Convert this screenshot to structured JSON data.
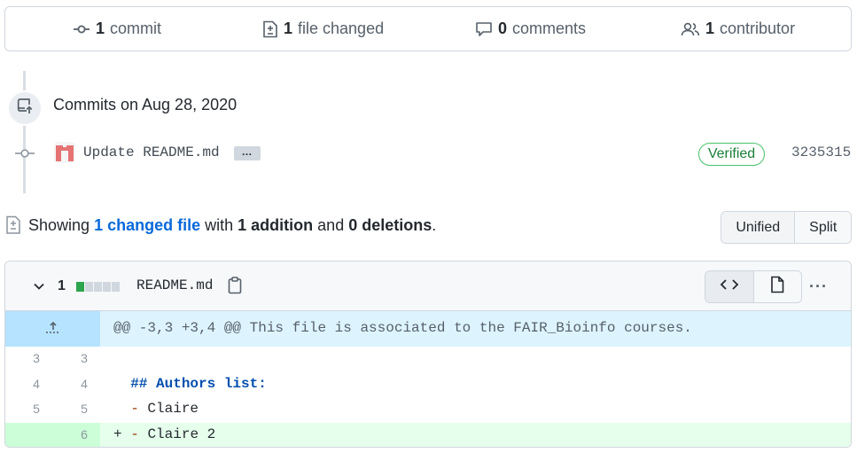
{
  "stats": {
    "commits": {
      "count": "1",
      "label": "commit"
    },
    "files": {
      "count": "1",
      "label": "file changed"
    },
    "comments": {
      "count": "0",
      "label": "comments"
    },
    "contributors": {
      "count": "1",
      "label": "contributor"
    }
  },
  "timeline": {
    "date_label": "Commits on Aug 28, 2020",
    "commit": {
      "message": "Update README.md",
      "ellipsis": "…",
      "verified": "Verified",
      "sha": "3235315"
    }
  },
  "summary": {
    "showing": "Showing",
    "link": "1 changed file",
    "with": "with",
    "additions": "1 addition",
    "and": "and",
    "deletions": "0 deletions",
    "period": "."
  },
  "view_toggle": {
    "unified": "Unified",
    "split": "Split",
    "selected": "Unified"
  },
  "file": {
    "change_count": "1",
    "name": "README.md",
    "more": "···",
    "diffstat": {
      "additions": 1,
      "deletions": 0,
      "colors": [
        "#2da44e",
        "#d0d7de",
        "#d0d7de",
        "#d0d7de",
        "#d0d7de"
      ]
    },
    "hunk_header": "@@ -3,3 +3,4 @@ This file is associated to the FAIR_Bioinfo courses.",
    "lines": [
      {
        "old": "3",
        "new": "3",
        "sign": "",
        "text": ""
      },
      {
        "old": "4",
        "new": "4",
        "sign": "",
        "text": "## Authors list:"
      },
      {
        "old": "5",
        "new": "5",
        "sign": "",
        "text": "Claire",
        "bullet": "-"
      },
      {
        "old": "",
        "new": "6",
        "sign": "+",
        "text": "Claire 2",
        "bullet": "-"
      }
    ]
  },
  "colors": {
    "link": "#0969da",
    "verified": "#1a7f37",
    "addition_bg": "#e6ffec",
    "hunk_bg": "#ddf4ff"
  }
}
